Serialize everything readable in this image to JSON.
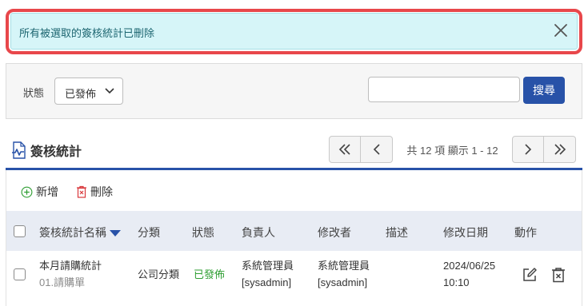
{
  "alert": {
    "message": "所有被選取的簽核統計已刪除"
  },
  "filter": {
    "status_label": "狀態",
    "status_value": "已發佈",
    "search_placeholder": "",
    "search_button": "搜尋"
  },
  "section": {
    "title": "簽核統計",
    "pager_info": "共 12 項 顯示 1 - 12"
  },
  "toolbar": {
    "add_label": "新增",
    "delete_label": "刪除"
  },
  "table": {
    "headers": {
      "name": "簽核統計名稱",
      "category": "分類",
      "status": "狀態",
      "owner": "負責人",
      "modifier": "修改者",
      "description": "描述",
      "modified_date": "修改日期",
      "actions": "動作"
    },
    "rows": [
      {
        "name": "本月請購統計",
        "sub": "01.請購單",
        "category": "公司分類",
        "status": "已發佈",
        "owner_name": "系統管理員",
        "owner_id": "[sysadmin]",
        "modifier_name": "系統管理員",
        "modifier_id": "[sysadmin]",
        "description": "",
        "date": "2024/06/25",
        "time": "10:10"
      }
    ]
  },
  "colors": {
    "primary": "#2852a8",
    "alert_bg": "#d6f5f8",
    "alert_text": "#1c6570",
    "highlight": "#e8474b",
    "published": "#2f9e33",
    "header_bg": "#e8ecf4"
  }
}
